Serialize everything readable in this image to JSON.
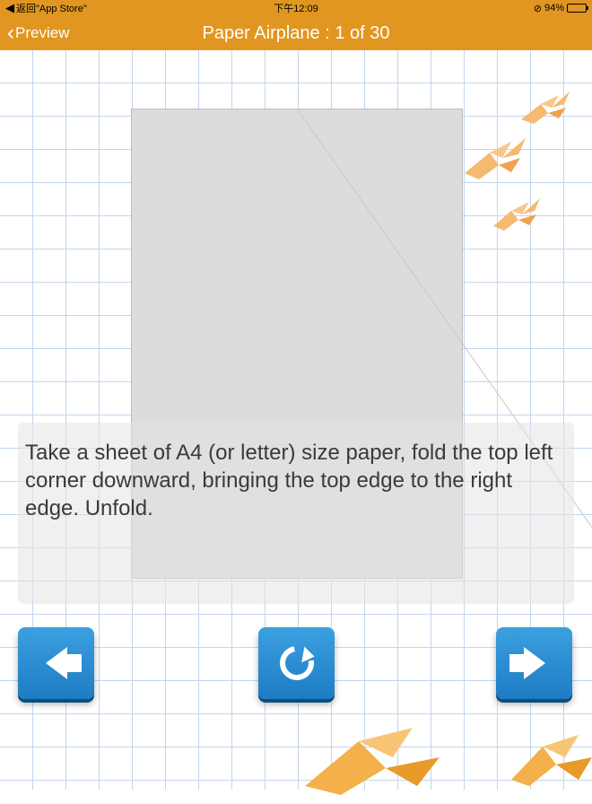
{
  "status": {
    "back_to_app": "返回\"App Store\"",
    "time": "下午12:09",
    "battery_pct": "94%"
  },
  "nav": {
    "back_label": "Preview",
    "title": "Paper Airplane : 1 of 30"
  },
  "instruction": "Take a sheet of A4 (or letter) size paper, fold the top left corner downward, bringing the top edge to the right edge. Unfold.",
  "controls": {
    "prev": "previous",
    "replay": "replay",
    "next": "next"
  }
}
